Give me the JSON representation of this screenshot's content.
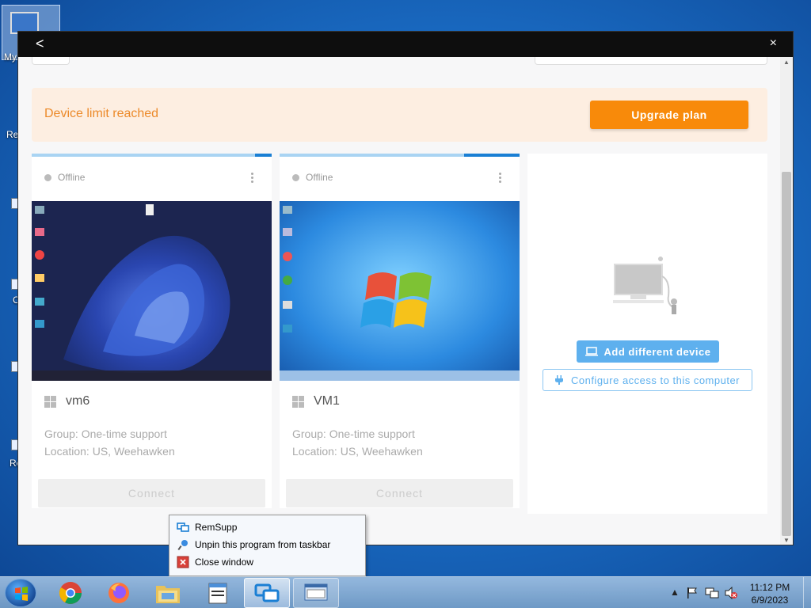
{
  "desktop": {
    "my_computer_label": "My",
    "peek_labels": [
      "Re",
      "Re",
      "C"
    ]
  },
  "window": {
    "back_glyph": "<",
    "close_glyph": "×"
  },
  "banner": {
    "message": "Device limit reached",
    "upgrade_label": "Upgrade plan"
  },
  "devices": [
    {
      "status": "Offline",
      "name": "vm6",
      "group": "Group: One-time support",
      "location": "Location: US, Weehawken",
      "connect_label": "Connect",
      "progress": 0.07
    },
    {
      "status": "Offline",
      "name": "VM1",
      "group": "Group: One-time support",
      "location": "Location: US, Weehawken",
      "connect_label": "Connect",
      "progress": 0.23
    }
  ],
  "add_device": {
    "add_label": "Add different device",
    "configure_label": "Configure access to this computer"
  },
  "context_menu": {
    "items": [
      {
        "label": "RemSupp",
        "icon": "remsupp-icon"
      },
      {
        "label": "Unpin this program from taskbar",
        "icon": "unpin-icon"
      },
      {
        "label": "Close window",
        "icon": "close-window-icon"
      }
    ]
  },
  "taskbar": {
    "apps": [
      "start",
      "chrome",
      "firefox",
      "file-explorer",
      "notepad",
      "remsupp",
      "keyboard-app"
    ],
    "time": "11:12 PM",
    "date": "6/9/2023"
  },
  "colors": {
    "accent_orange": "#f88a0a",
    "banner_bg": "#fdeee1",
    "link_blue": "#5eb0ee"
  }
}
